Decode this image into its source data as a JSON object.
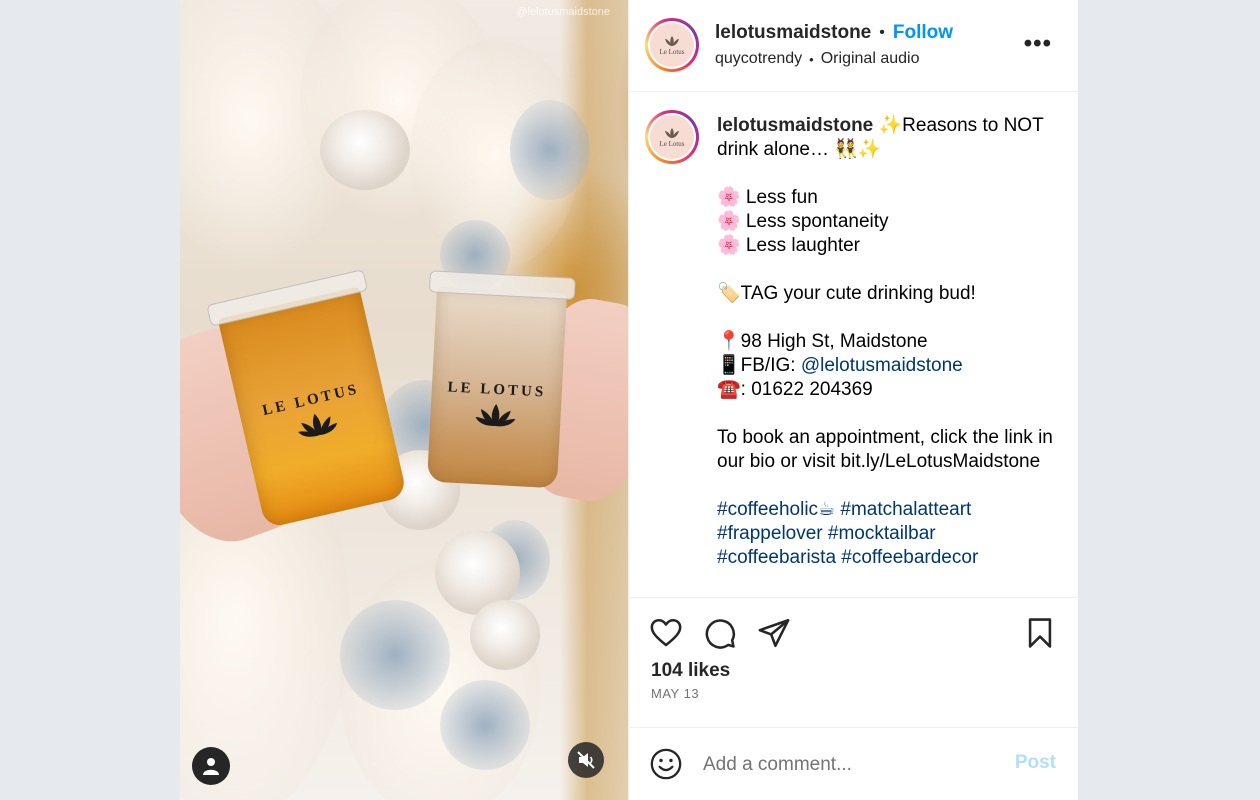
{
  "media": {
    "watermark": "@lelotusmaidstone",
    "cup_brand": "LE LOTUS",
    "user_icon": "user-icon",
    "mute_icon": "muted-speaker-icon"
  },
  "header": {
    "username": "lelotusmaidstone",
    "separator": "•",
    "follow_label": "Follow",
    "audio_author": "quycotrendy",
    "audio_separator": "•",
    "audio_title": "Original audio",
    "more_label": "•••",
    "avatar_text": "Le Lotus"
  },
  "caption": {
    "username": "lelotusmaidstone",
    "headline": " ✨Reasons to NOT drink alone… 👯✨",
    "reasons": [
      "🌸 Less fun",
      "🌸 Less spontaneity",
      "🌸 Less laughter"
    ],
    "tag_line": "🏷️TAG your cute drinking bud!",
    "address": "📍98 High St, Maidstone",
    "social_prefix": "📱FB/IG: ",
    "social_handle": "@lelotusmaidstone",
    "phone": "☎️: 01622 204369",
    "booking": "To book an appointment, click the link in our bio or visit bit.ly/LeLotusMaidstone",
    "hashtags_line1": [
      "#coffeeholic☕",
      "#matchalatteart"
    ],
    "hashtags_line2": [
      "#frappelover",
      "#mocktailbar"
    ],
    "hashtags_line3": [
      "#coffeebarista",
      "#coffeebardecor"
    ]
  },
  "actions": {
    "like_icon": "heart-icon",
    "comment_icon": "comment-bubble-icon",
    "share_icon": "paper-plane-icon",
    "save_icon": "bookmark-icon",
    "likes": "104 likes",
    "date": "MAY 13"
  },
  "comment": {
    "emoji_icon": "smiley-icon",
    "placeholder": "Add a comment...",
    "post_label": "Post"
  },
  "colors": {
    "follow": "#0095f6",
    "link": "#00376b",
    "post_disabled": "#b2dffc",
    "page_background": "#e6e9ee"
  }
}
